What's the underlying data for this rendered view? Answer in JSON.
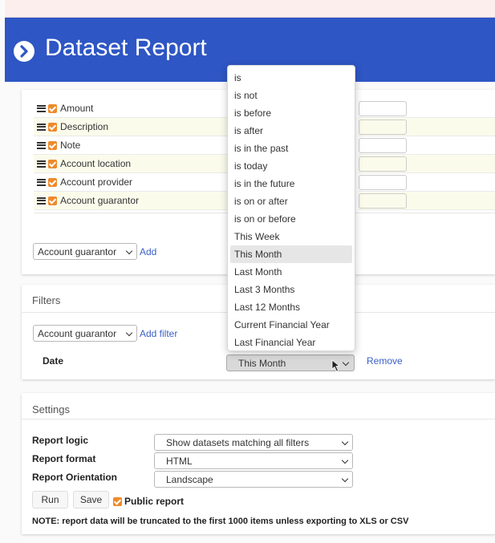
{
  "header": {
    "title": "Dataset Report"
  },
  "columns": {
    "fields": [
      {
        "label": "Amount",
        "checked": true
      },
      {
        "label": "Description",
        "checked": true
      },
      {
        "label": "Note",
        "checked": true
      },
      {
        "label": "Account location",
        "checked": true
      },
      {
        "label": "Account provider",
        "checked": true
      },
      {
        "label": "Account guarantor",
        "checked": true
      }
    ],
    "add_select": "Account guarantor",
    "add_link": "Add"
  },
  "filters": {
    "title": "Filters",
    "add_select": "Account guarantor",
    "add_link": "Add filter",
    "date_label": "Date",
    "date_value": "This Month",
    "remove_link": "Remove"
  },
  "dropdown": {
    "options": [
      "is",
      "is not",
      "is before",
      "is after",
      "is in the past",
      "is today",
      "is in the future",
      "is on or after",
      "is on or before",
      "This Week",
      "This Month",
      "Last Month",
      "Last 3 Months",
      "Last 12 Months",
      "Current Financial Year",
      "Last Financial Year"
    ],
    "selected": "This Month"
  },
  "settings": {
    "title": "Settings",
    "logic_label": "Report logic",
    "logic_value": "Show datasets matching all filters",
    "format_label": "Report format",
    "format_value": "HTML",
    "orientation_label": "Report Orientation",
    "orientation_value": "Landscape",
    "run_label": "Run",
    "save_label": "Save",
    "public_label": "Public report",
    "public_checked": true,
    "note": "NOTE: report data will be truncated to the first 1000 items unless exporting to XLS or CSV"
  },
  "colors": {
    "header": "#2e56c4",
    "accent": "#ef8a2b",
    "link": "#3a5fc8"
  }
}
